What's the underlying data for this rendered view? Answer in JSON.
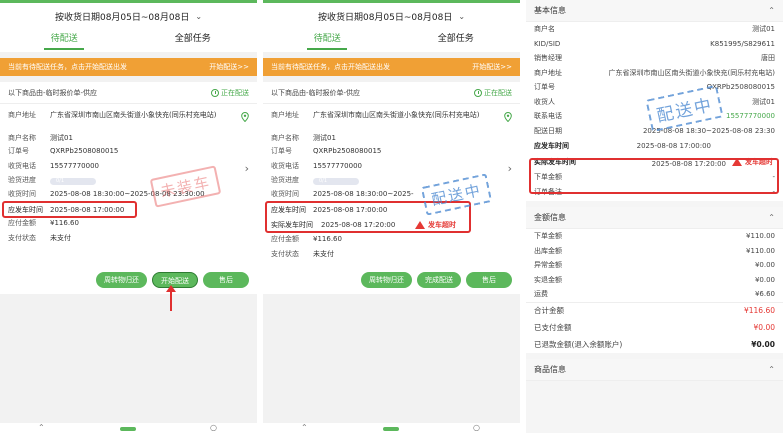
{
  "common": {
    "date_filter": "按收货日期08月05日~08月08日",
    "tab_pending": "待配送",
    "tab_all": "全部任务",
    "notice_text": "当前有待配送任务，点击开始配送出发",
    "notice_action": "开始配送>>",
    "order_source": "以下商品由-临时报价单-供应",
    "order_status": "正在配送"
  },
  "order": {
    "merchant_address_label": "商户地址",
    "merchant_address": "广东省深圳市南山区南头街道小象快充(同乐村充电站)",
    "merchant_name_label": "商户名称",
    "merchant_name": "测试01",
    "order_no_label": "订单号",
    "order_no": "QXRPb2508080015",
    "phone_label": "收货电话",
    "phone": "15577770000",
    "inspection_label": "验货进度",
    "inspection_value": "0/1",
    "receive_time_label": "收货时间",
    "receive_time": "2025-08-08 18:30:00~2025-08-08 23:30:00",
    "receive_time_p2": "2025-08-08 18:30:00~2025-",
    "planned_depart_label": "应发车时间",
    "planned_depart": "2025-08-08  17:00:00",
    "actual_depart_label": "实际发车时间",
    "actual_depart": "2025-08-08  17:20:00",
    "late_label": "发车超时",
    "amount_label": "应付金额",
    "amount": "¥116.60",
    "pay_status_label": "支付状态",
    "pay_status": "未支付"
  },
  "panel1": {
    "stamp": "未装车",
    "btn_return": "周转物归还",
    "btn_start": "开始配送",
    "btn_after_sale": "售后"
  },
  "panel2": {
    "stamp": "配送中",
    "btn_return": "周转物归还",
    "btn_complete": "完成配送",
    "btn_after_sale": "售后"
  },
  "panel3": {
    "stamp": "配送中",
    "basic_title": "基本信息",
    "basic": [
      {
        "k": "商户名",
        "v": "测试01"
      },
      {
        "k": "KID/SID",
        "v": "K851995/S829611"
      },
      {
        "k": "销售经理",
        "v": "唐田"
      },
      {
        "k": "商户地址",
        "v": "广东省深圳市南山区南头街道小象快充(同乐村充电站)"
      },
      {
        "k": "订单号",
        "v": "QXRPb2508080015"
      },
      {
        "k": "收货人",
        "v": "测试01"
      },
      {
        "k": "联系电话",
        "v": "15577770000"
      },
      {
        "k": "配送日期",
        "v": "2025-08-08 18:30~2025-08-08 23:30"
      },
      {
        "k": "应发车时间",
        "v": "2025-08-08  17:00:00"
      },
      {
        "k": "实际发车时间",
        "v": "2025-08-08  17:20:00"
      },
      {
        "k": "下单金额",
        "v": "-"
      },
      {
        "k": "订单备注",
        "v": "-"
      }
    ],
    "amount_title": "金额信息",
    "amounts": [
      {
        "k": "下单金额",
        "v": "¥110.00"
      },
      {
        "k": "出库金额",
        "v": "¥110.00"
      },
      {
        "k": "异常金额",
        "v": "¥0.00"
      },
      {
        "k": "实退金额",
        "v": "¥0.00"
      },
      {
        "k": "运费",
        "v": "¥6.60"
      },
      {
        "k": "合计金额",
        "v": "¥116.60"
      },
      {
        "k": "已支付金额",
        "v": "¥0.00"
      },
      {
        "k": "已退款金额(退入余额账户)",
        "v": "¥0.00"
      }
    ],
    "product_title": "商品信息"
  },
  "colors": {
    "accent": "#5cb85c",
    "notice": "#f0a035",
    "alert": "#e03030"
  }
}
